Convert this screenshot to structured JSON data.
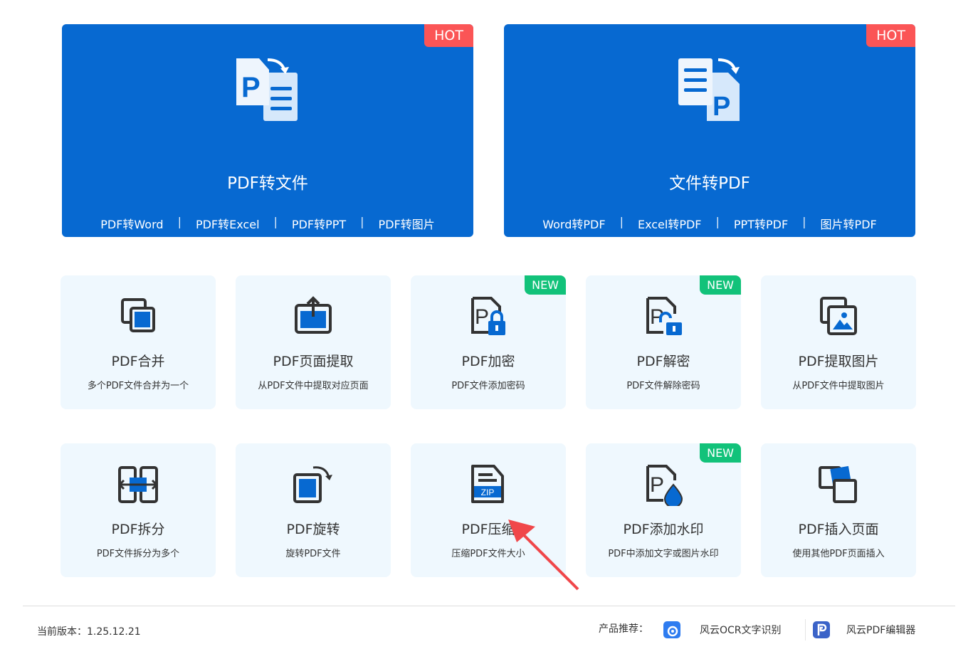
{
  "top_cards": [
    {
      "title": "PDF转文件",
      "badge": "HOT",
      "links": [
        "PDF转Word",
        "PDF转Excel",
        "PDF转PPT",
        "PDF转图片"
      ]
    },
    {
      "title": "文件转PDF",
      "badge": "HOT",
      "links": [
        "Word转PDF",
        "Excel转PDF",
        "PPT转PDF",
        "图片转PDF"
      ]
    }
  ],
  "separator": "|",
  "tools": [
    {
      "title": "PDF合并",
      "desc": "多个PDF文件合并为一个",
      "icon": "merge-icon"
    },
    {
      "title": "PDF页面提取",
      "desc": "从PDF文件中提取对应页面",
      "icon": "extract-page-icon"
    },
    {
      "title": "PDF加密",
      "desc": "PDF文件添加密码",
      "icon": "lock-icon",
      "badge": "NEW"
    },
    {
      "title": "PDF解密",
      "desc": "PDF文件解除密码",
      "icon": "unlock-icon",
      "badge": "NEW"
    },
    {
      "title": "PDF提取图片",
      "desc": "从PDF文件中提取图片",
      "icon": "image-icon"
    },
    {
      "title": "PDF拆分",
      "desc": "PDF文件拆分为多个",
      "icon": "split-icon"
    },
    {
      "title": "PDF旋转",
      "desc": "旋转PDF文件",
      "icon": "rotate-icon"
    },
    {
      "title": "PDF压缩",
      "desc": "压缩PDF文件大小",
      "icon": "zip-icon",
      "zip_label": "ZIP"
    },
    {
      "title": "PDF添加水印",
      "desc": "PDF中添加文字或图片水印",
      "icon": "watermark-icon",
      "badge": "NEW"
    },
    {
      "title": "PDF插入页面",
      "desc": "使用其他PDF页面插入",
      "icon": "insert-page-icon"
    }
  ],
  "footer": {
    "version": "当前版本：1.25.12.21",
    "recommend_label": "产品推荐：",
    "products": [
      "风云OCR文字识别",
      "风云PDF编辑器"
    ]
  },
  "colors": {
    "primary": "#0769d1",
    "hot": "#fb5556",
    "new": "#12c27a",
    "card_bg": "#eff8fe",
    "annotation_arrow": "#f0474a"
  }
}
